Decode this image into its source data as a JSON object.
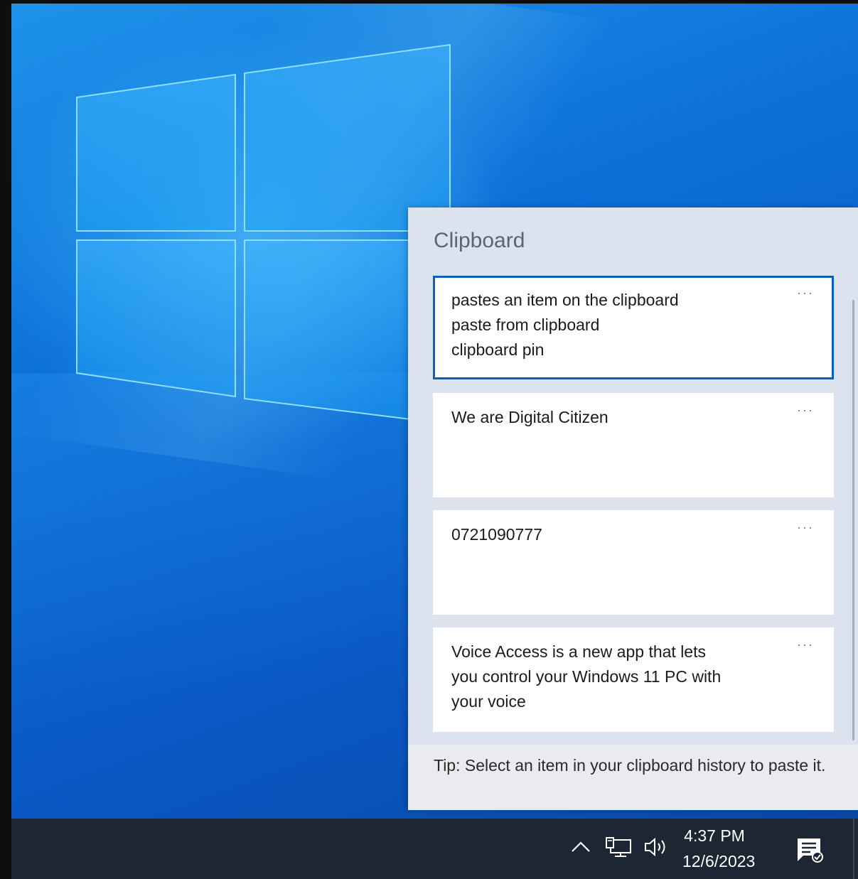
{
  "clipboard": {
    "title": "Clipboard",
    "items": [
      {
        "text": "pastes an item on the clipboard\npaste from clipboard\nclipboard pin",
        "more": "···"
      },
      {
        "text": "We are Digital Citizen",
        "more": "···"
      },
      {
        "text": "0721090777",
        "more": "···"
      },
      {
        "text": "Voice Access is a new app that lets\nyou control your Windows 11 PC with\nyour voice",
        "more": "···"
      }
    ],
    "tip": "Tip: Select an item in your clipboard history to paste it."
  },
  "taskbar": {
    "time": "4:37 PM",
    "date": "12/6/2023",
    "icons": [
      "chevron-up-icon",
      "network-icon",
      "volume-icon",
      "notification-icon"
    ]
  },
  "colors": {
    "selected_border": "#0a5fb8",
    "taskbar": "#1d2633",
    "panel": "#dde3ee"
  }
}
